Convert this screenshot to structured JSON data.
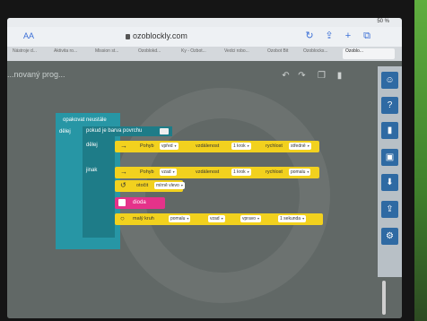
{
  "status": {
    "battery": "50 %"
  },
  "browser": {
    "aa_label": "AA",
    "url": "ozoblockly.com",
    "tabs": [
      "Nástroje d...",
      "Aktivita ro...",
      "Mission st...",
      "Ozoblokd...",
      "Ky - Ozbot...",
      "Vedci robo...",
      "Ozobot Bit",
      "Ozoblocks...",
      "Ozoblo..."
    ]
  },
  "app": {
    "title": "...novaný prog...",
    "blocks": {
      "repeat_forever": "opakovat neustále",
      "loop_label": "dělej",
      "if_label": "pokud je barva povrchu",
      "do_label": "dělej",
      "else_label": "jinak",
      "move1": {
        "label": "Pohyb",
        "direction": "vpřed",
        "distance_label": "vzdálenost",
        "distance": "1 krok",
        "speed_label": "rychlost",
        "speed": "středně"
      },
      "move2": {
        "label": "Pohyb",
        "direction": "vzad",
        "distance_label": "vzdálenost",
        "distance": "1 krok",
        "speed_label": "rychlost",
        "speed": "pomalu"
      },
      "rotate": {
        "label": "otočit",
        "direction": "mírně vlevo"
      },
      "light": {
        "label": "dioda"
      },
      "circle": {
        "label": "malý kruh",
        "speed": "pomalu",
        "direction": "vzad",
        "turn": "vpravo",
        "duration": "1 sekunda"
      }
    }
  },
  "colors": {
    "loop": "#2796a5",
    "motion": "#f2d11e",
    "light": "#e5328a",
    "toolbox_icon": "#2f6aa3"
  }
}
